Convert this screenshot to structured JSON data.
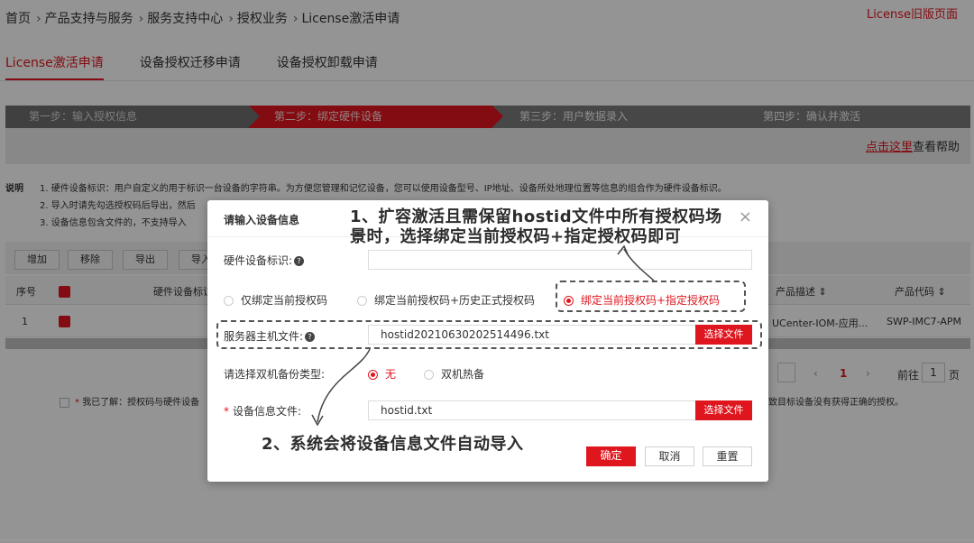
{
  "breadcrumb": [
    "首页",
    "产品支持与服务",
    "服务支持中心",
    "授权业务",
    "License激活申请"
  ],
  "breadcrumb_sep": "›",
  "old_version_link": "License旧版页面",
  "tabs": [
    {
      "label": "License激活申请",
      "active": true
    },
    {
      "label": "设备授权迁移申请",
      "active": false
    },
    {
      "label": "设备授权卸载申请",
      "active": false
    }
  ],
  "steps": [
    "第一步：输入授权信息",
    "第二步：绑定硬件设备",
    "第三步：用户数据录入",
    "第四步：确认并激活"
  ],
  "help": {
    "link": "点击这里",
    "text": "查看帮助"
  },
  "note": {
    "title": "说明",
    "lines": [
      "1. 硬件设备标识：用户自定义的用于标识一台设备的字符串。为方便您管理和记忆设备，您可以使用设备型号、IP地址、设备所处地理位置等信息的组合作为硬件设备标识。",
      "2. 导入时请先勾选授权码后导出，然后",
      "3. 设备信息包含文件的，不支持导入"
    ]
  },
  "toolbar": {
    "add": "增加",
    "remove": "移除",
    "export": "导出",
    "import": "导入"
  },
  "table": {
    "headers": {
      "index": "序号",
      "hwid": "硬件设备标识",
      "desc": "产品描述 ⇕",
      "code": "产品代码 ⇕"
    },
    "row": {
      "index": "1",
      "desc": "UCenter-IOM-应用...",
      "code": "SWP-IMC7-APM"
    }
  },
  "pager": {
    "prev": "‹",
    "page": "1",
    "next": "›",
    "goto": "前往",
    "goto_value": "1",
    "page_unit": "页"
  },
  "agree": {
    "text": "我已了解：授权码与硬件设备",
    "tail": "致目标设备没有获得正确的授权。"
  },
  "modal": {
    "title": "请输入设备信息",
    "close": "×",
    "hwid_label": "硬件设备标识:",
    "hwid_value": "",
    "bind_options": [
      {
        "label": "仅绑定当前授权码",
        "selected": false
      },
      {
        "label": "绑定当前授权码+历史正式授权码",
        "selected": false
      },
      {
        "label": "绑定当前授权码+指定授权码",
        "selected": true
      }
    ],
    "host_label": "服务器主机文件:",
    "host_value": "hostid20210630202514496.txt",
    "select_file": "选择文件",
    "backup_label": "请选择双机备份类型:",
    "backup_options": [
      {
        "label": "无",
        "selected": true
      },
      {
        "label": "双机热备",
        "selected": false
      }
    ],
    "devinfo_label": "设备信息文件:",
    "devinfo_value": "hostid.txt",
    "ok": "确定",
    "cancel": "取消",
    "reset": "重置"
  },
  "annotations": {
    "callout1_line1": "1、扩容激活且需保留hostid文件中所有授权码场",
    "callout1_line2": "景时，选择绑定当前授权码+指定授权码即可",
    "callout2": "2、系统会将设备信息文件自动导入"
  },
  "colors": {
    "accent": "#e0161e",
    "step_gray": "#7a7a7a"
  }
}
